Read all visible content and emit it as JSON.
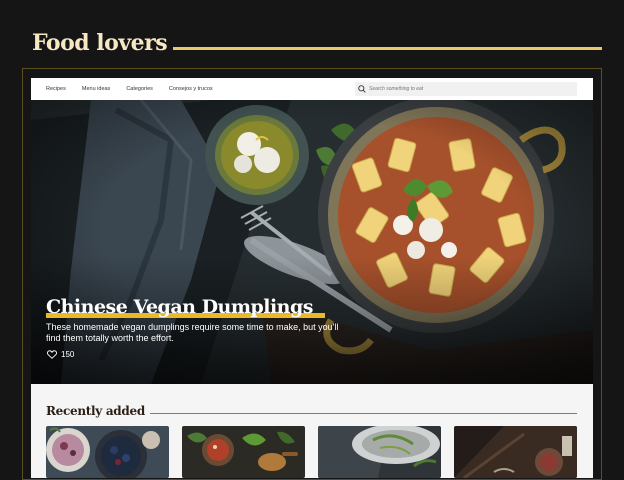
{
  "brand": {
    "title": "Food lovers",
    "accent": "#e9c869"
  },
  "nav": {
    "links": [
      "Recipes",
      "Menu ideas",
      "Categories",
      "Consejos y trucos"
    ],
    "search_placeholder": "Search something to eat"
  },
  "hero": {
    "title": "Chinese Vegan Dumplings",
    "description": "These homemade vegan dumplings require some time to make, but you'll find them totally worth the effort.",
    "likes": "150",
    "highlight": "#e9b928"
  },
  "recent": {
    "title": "Recently added",
    "cards": [
      {
        "icon": "berries-bowl-photo"
      },
      {
        "icon": "salad-sauce-photo"
      },
      {
        "icon": "plated-greens-photo"
      },
      {
        "icon": "dark-board-dish-photo"
      }
    ]
  }
}
